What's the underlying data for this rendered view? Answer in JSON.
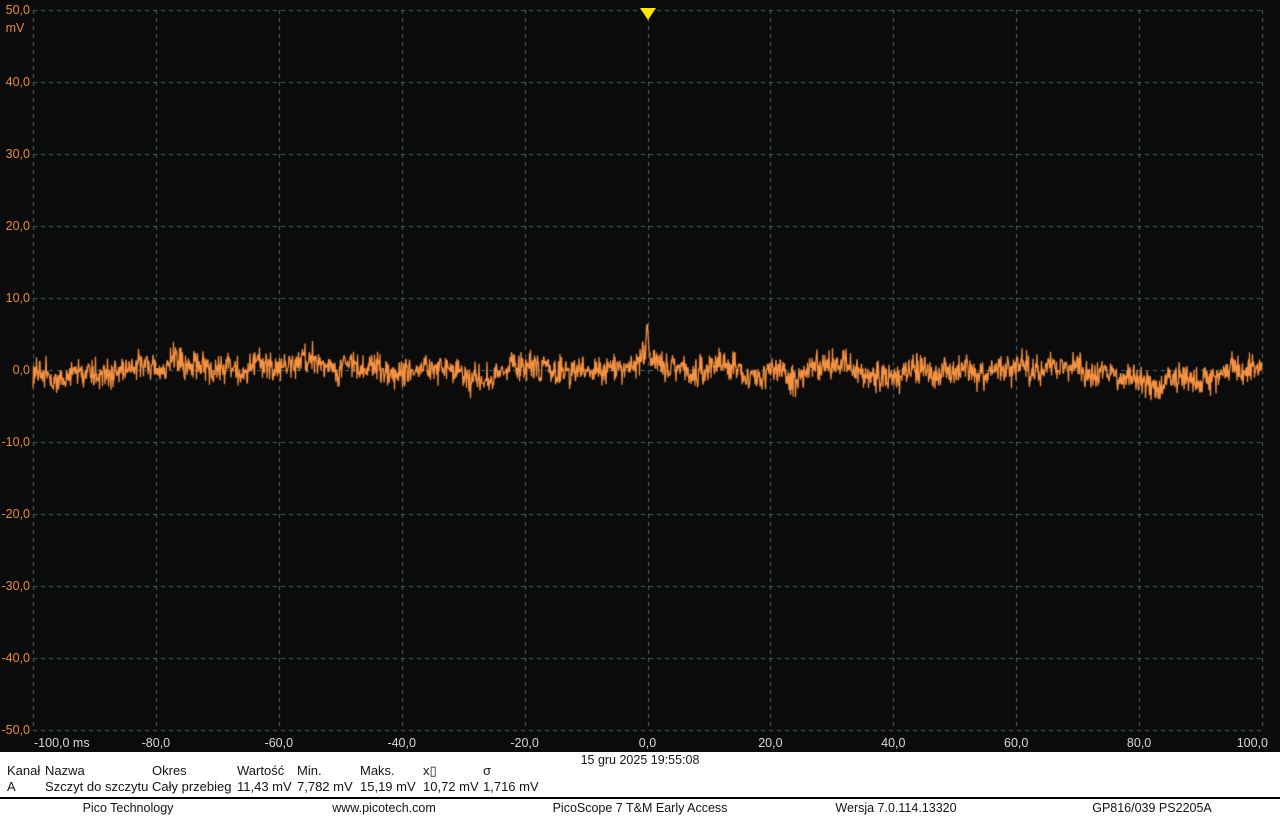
{
  "app": {
    "name": "PicoScope 7 T&M Early Access",
    "version_label": "Wersja 7.0.114.13320",
    "device": "GP816/039 PS2205A",
    "vendor": "Pico Technology",
    "website": "www.picotech.com"
  },
  "timestamp": "15 gru 2025 19:55:08",
  "colors": {
    "plot_bg": "#0b0b0c",
    "grid": "#3f6b6e",
    "channel_a": "#f79240",
    "y_label": "#e78c3a",
    "x_label": "#d9d9d9",
    "trigger": "#ffe600",
    "panel_bg": "#ffffff",
    "panel_text": "#141414"
  },
  "chart_data": {
    "type": "line",
    "title": "",
    "xlabel": "ms",
    "ylabel": "mV",
    "x_axis": {
      "min": -100.0,
      "max": 100.0,
      "tick_step": 20.0,
      "unit": "ms",
      "tick_labels": [
        "-100,0 ms",
        "-80,0",
        "-60,0",
        "-40,0",
        "-20,0",
        "0,0",
        "20,0",
        "40,0",
        "60,0",
        "80,0",
        "100,0"
      ]
    },
    "y_axis": {
      "min": -50.0,
      "max": 50.0,
      "tick_step": 10.0,
      "unit": "mV",
      "unit_label": "mV",
      "tick_labels": [
        "50,0",
        "40,0",
        "30,0",
        "20,0",
        "10,0",
        "0,0",
        "-10,0",
        "-20,0",
        "-30,0",
        "-40,0",
        "-50,0"
      ]
    },
    "grid": {
      "visible": true,
      "style": "dashed"
    },
    "trigger": {
      "time_ms": 0.0,
      "position": "top"
    },
    "series": [
      {
        "name": "Channel A",
        "description": "broadband noise centered near 0 mV with a positive spike at the 0 ms trigger point",
        "mean_mV": 0.0,
        "sigma_mV": 1.716,
        "max_mV": 6.3,
        "min_mV": -5.7,
        "spike_at_ms": 0.0,
        "spike_peak_mV": 6.3,
        "noise_seed": 20251215
      }
    ]
  },
  "measurements": {
    "channel_row": "A",
    "columns": [
      {
        "header": "Kanał",
        "value": "A"
      },
      {
        "header": "Nazwa",
        "value": "Szczyt do szczytu"
      },
      {
        "header": "Okres",
        "value": "Cały przebieg"
      },
      {
        "header": "Wartość",
        "value": "11,43 mV"
      },
      {
        "header": "Min.",
        "value": "7,782 mV"
      },
      {
        "header": "Maks.",
        "value": "15,19 mV"
      },
      {
        "header": "x▯",
        "value": "10,72 mV"
      },
      {
        "header": "σ",
        "value": "1,716 mV"
      }
    ]
  },
  "footer": {
    "items": [
      "Pico Technology",
      "www.picotech.com",
      "PicoScope 7 T&M Early Access",
      "Wersja 7.0.114.13320",
      "GP816/039 PS2205A"
    ]
  }
}
